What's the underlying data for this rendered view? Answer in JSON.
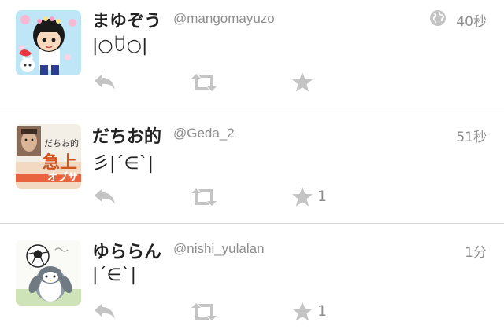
{
  "colors": {
    "icon": "#c4c4c4",
    "meta": "#8e8e8e",
    "divider": "#d6d6d6"
  },
  "tweets": [
    {
      "display_name": "まゆぞう",
      "handle": "@mangomayuzo",
      "time": "40秒",
      "has_globe": true,
      "text": "|○ꇴ○|",
      "favorites": ""
    },
    {
      "display_name": "だちお的",
      "handle": "@Geda_2",
      "time": "51秒",
      "has_globe": false,
      "text": "彡|ˊ∈ˋ|",
      "favorites": "1",
      "avatar_text": [
        "だちお的",
        "急上",
        "オブサ"
      ]
    },
    {
      "display_name": "ゆららん",
      "handle": "@nishi_yulalan",
      "time": "1分",
      "has_globe": false,
      "text": "|ˊ∈ˋ|",
      "favorites": "1"
    }
  ]
}
